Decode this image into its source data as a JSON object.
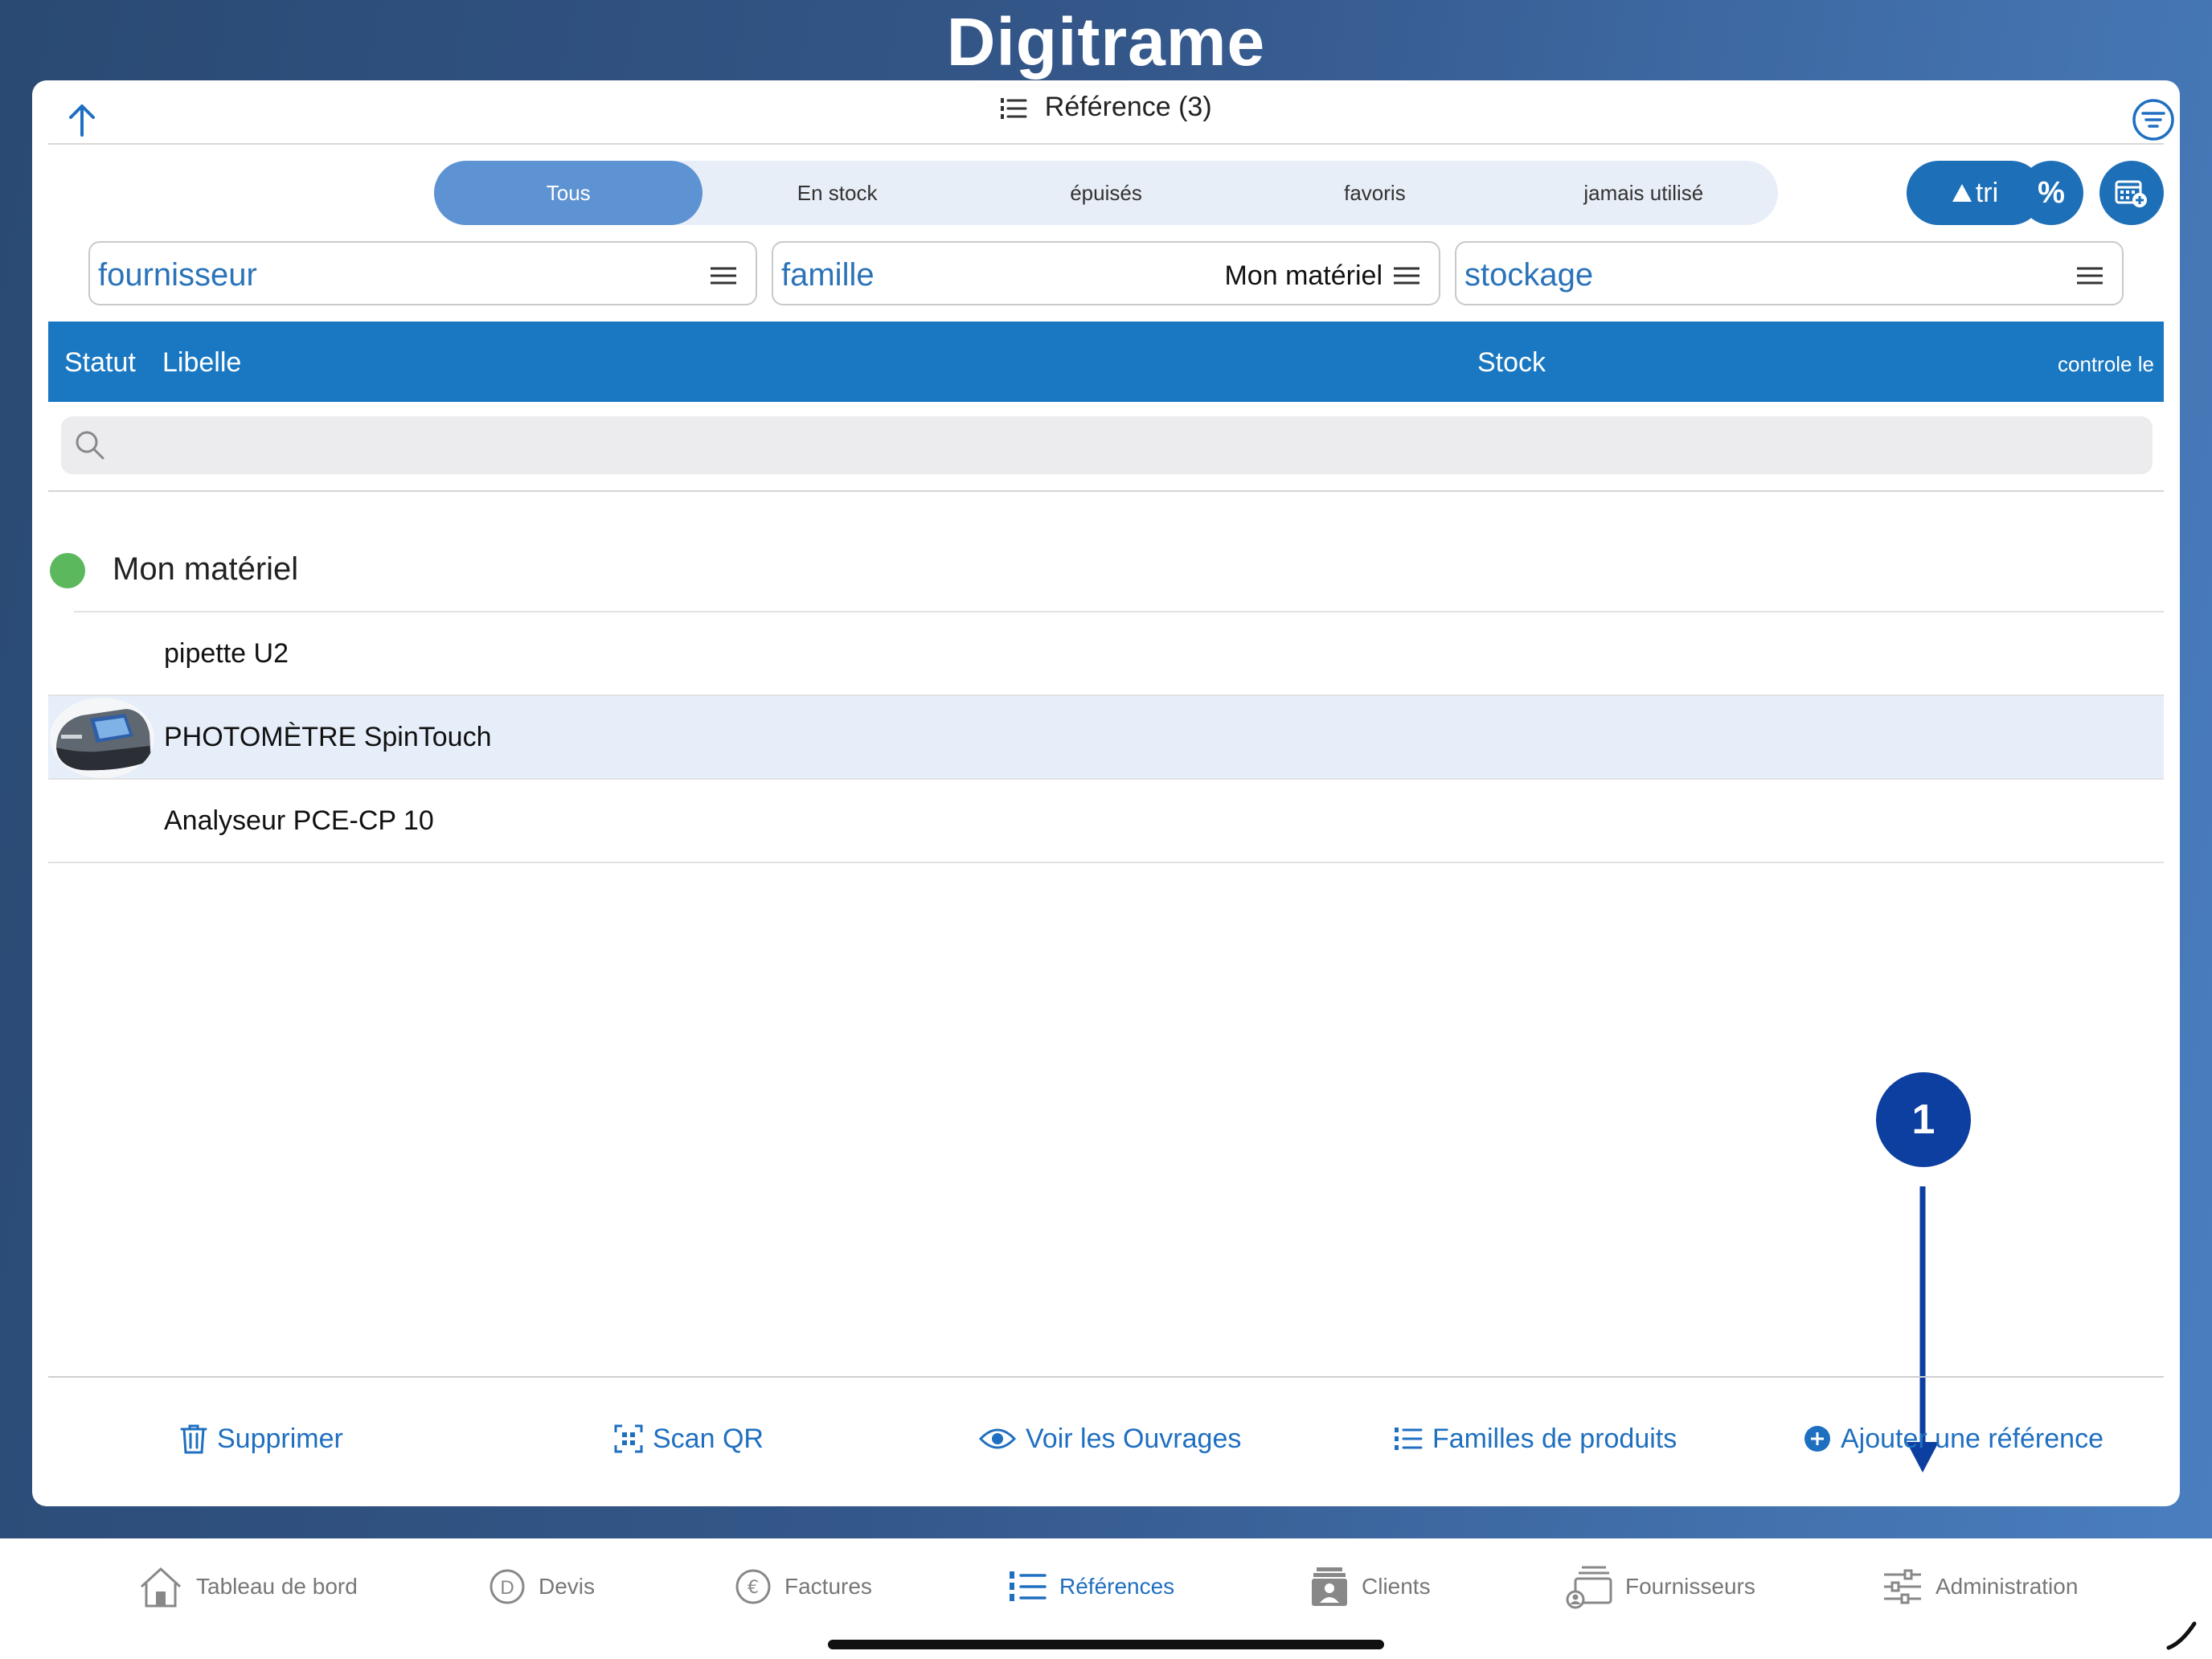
{
  "app": {
    "logo": "Digitrame"
  },
  "header": {
    "title": "Référence (3)"
  },
  "segments": {
    "items": [
      {
        "label": "Tous",
        "active": true
      },
      {
        "label": "En stock",
        "active": false
      },
      {
        "label": "épuisés",
        "active": false
      },
      {
        "label": "favoris",
        "active": false
      },
      {
        "label": "jamais utilisé",
        "active": false
      }
    ]
  },
  "actions": {
    "tri_label": "tri",
    "percent_label": "%"
  },
  "filters": {
    "fournisseur": {
      "label": "fournisseur",
      "value": ""
    },
    "famille": {
      "label": "famille",
      "value": "Mon matériel"
    },
    "stockage": {
      "label": "stockage",
      "value": ""
    }
  },
  "table": {
    "columns": {
      "statut": "Statut",
      "libelle": "Libelle",
      "stock": "Stock",
      "controle": "controle le"
    },
    "search_placeholder": "",
    "group": {
      "title": "Mon matériel",
      "status_color": "#5cb85c"
    },
    "rows": [
      {
        "label": "pipette U2",
        "has_image": false,
        "selected": false
      },
      {
        "label": "PHOTOMÈTRE SpinTouch",
        "has_image": true,
        "selected": true
      },
      {
        "label": "Analyseur PCE-CP 10",
        "has_image": false,
        "selected": false
      }
    ]
  },
  "annotation": {
    "number": "1"
  },
  "footer": {
    "supprimer": "Supprimer",
    "scan_qr": "Scan QR",
    "voir_ouvrages": "Voir les Ouvrages",
    "familles": "Familles de produits",
    "ajouter": "Ajouter une référence"
  },
  "tabbar": {
    "items": [
      {
        "label": "Tableau de bord",
        "icon": "home-icon",
        "active": false
      },
      {
        "label": "Devis",
        "icon": "devis-icon",
        "active": false
      },
      {
        "label": "Factures",
        "icon": "euro-icon",
        "active": false
      },
      {
        "label": "Références",
        "icon": "numbered-list-icon",
        "active": true
      },
      {
        "label": "Clients",
        "icon": "clients-icon",
        "active": false
      },
      {
        "label": "Fournisseurs",
        "icon": "fournisseurs-icon",
        "active": false
      },
      {
        "label": "Administration",
        "icon": "sliders-icon",
        "active": false
      }
    ]
  },
  "colors": {
    "accent": "#1f6fc0",
    "header_bar": "#1a78c2",
    "segment_active": "#5d93d2",
    "annotation": "#0d3fa0"
  }
}
